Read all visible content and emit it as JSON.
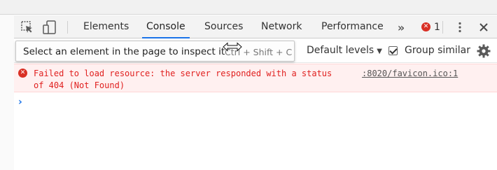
{
  "tabs": [
    {
      "label": "Elements"
    },
    {
      "label": "Console"
    },
    {
      "label": "Sources"
    },
    {
      "label": "Network"
    },
    {
      "label": "Performance"
    }
  ],
  "more_tabs_icon": "double-chevron-right-icon",
  "error_badge": {
    "count": "1",
    "icon": "error-circle-icon"
  },
  "toolbar_icons": [
    "inspect-element-icon",
    "device-toggle-icon",
    "kebab-menu-icon",
    "close-icon"
  ],
  "tooltip": {
    "text": "Select an element in the page to inspect it",
    "shortcut": "Ctrl + Shift + C"
  },
  "filter": {
    "levels_label": "Default levels",
    "group_similar_label": "Group similar",
    "group_similar_checked": true,
    "settings_icon": "gear-icon"
  },
  "console": {
    "messages": [
      {
        "level": "error",
        "text": "Failed to load resource: the server responded with a status of 404 (Not Found)",
        "source": ":8020/favicon.ico:1"
      }
    ],
    "prompt_icon": "chevron-right-icon"
  },
  "colors": {
    "accent": "#1a73e8",
    "error": "#d93025",
    "error_bg": "#fff0f0",
    "error_text": "#e0201f"
  }
}
